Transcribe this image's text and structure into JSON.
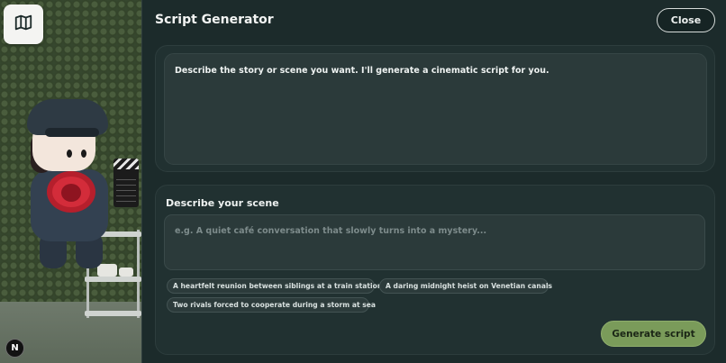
{
  "header": {
    "title": "Script Generator",
    "close_label": "Close"
  },
  "output": {
    "text": "Describe the story or scene you want. I'll generate a cinematic script for you."
  },
  "scene_form": {
    "label": "Describe your scene",
    "placeholder": "e.g. A quiet café conversation that slowly turns into a mystery...",
    "value": "",
    "suggestions": [
      "A heartfelt reunion between siblings at a train station",
      "A daring midnight heist on Venetian canals",
      "Two rivals forced to cooperate during a storm at sea"
    ],
    "generate_label": "Generate script"
  },
  "scene_view": {
    "map_button_icon": "map-icon",
    "badge": "N"
  },
  "colors": {
    "panel_bg": "#1c2b2b",
    "card_bg": "#213131",
    "accent": "#7a9b5a"
  }
}
